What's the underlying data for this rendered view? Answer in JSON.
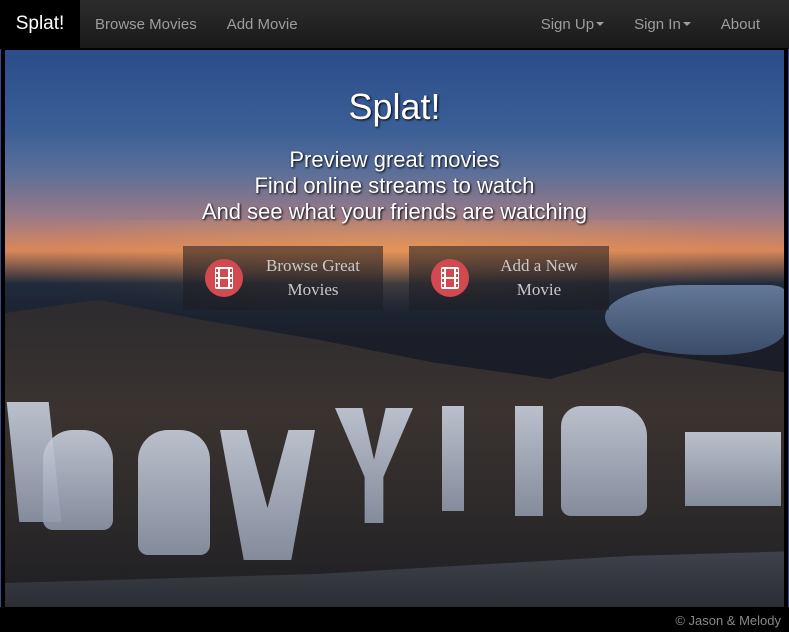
{
  "navbar": {
    "brand": "Splat!",
    "left_items": [
      "Browse Movies",
      "Add Movie"
    ],
    "right_items": [
      {
        "label": "Sign Up",
        "dropdown": true
      },
      {
        "label": "Sign In",
        "dropdown": true
      },
      {
        "label": "About",
        "dropdown": false
      }
    ]
  },
  "hero": {
    "title": "Splat!",
    "taglines": [
      "Preview great movies",
      "Find online streams to watch",
      "And see what your friends are watching"
    ],
    "buttons": [
      {
        "label_line1": "Browse Great",
        "label_line2": "Movies",
        "icon": "film-icon"
      },
      {
        "label_line1": "Add a New",
        "label_line2": "Movie",
        "icon": "film-icon"
      }
    ]
  },
  "footer": {
    "text": "© Jason & Melody"
  },
  "colors": {
    "navbar_bg": "#222222",
    "brand_bg": "#000000",
    "nav_text": "#9d9d9d",
    "icon_red": "#d24a4f"
  }
}
